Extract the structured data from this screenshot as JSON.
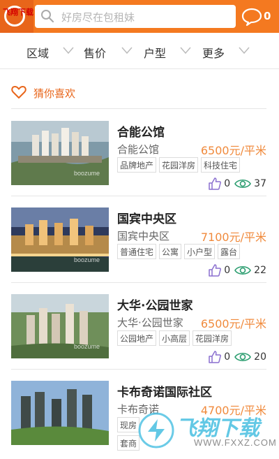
{
  "header": {
    "watermark": "飞翔下载 www.FXXZ.com",
    "search_placeholder": "好房尽在包租妹",
    "message_count": "0",
    "colors": {
      "bar": "#f47920",
      "accent": "#e8651a",
      "price": "#f08a3c",
      "eye": "#2a9d6f",
      "like": "#8a6fcf"
    }
  },
  "filters": [
    {
      "label": "区域",
      "icon": "chevron-down-icon"
    },
    {
      "label": "售价",
      "icon": "chevron-down-icon"
    },
    {
      "label": "户型",
      "icon": "chevron-down-icon"
    },
    {
      "label": "更多",
      "icon": "chevron-down-icon"
    }
  ],
  "section": {
    "title": "猜你喜欢",
    "icon": "heart-icon"
  },
  "listings": [
    {
      "title": "合能公馆",
      "subname": "合能公馆",
      "price": "6500元/平米",
      "tags": [
        "品牌地产",
        "花园洋房",
        "科技住宅"
      ],
      "likes": "0",
      "views": "37"
    },
    {
      "title": "国宾中央区",
      "subname": "国宾中央区",
      "price": "7100元/平米",
      "tags": [
        "普通住宅",
        "公寓",
        "小户型",
        "露台"
      ],
      "likes": "0",
      "views": "22"
    },
    {
      "title": "大华·公园世家",
      "subname": "大华·公园世家",
      "price": "6500元/平米",
      "tags": [
        "公园地产",
        "小高层",
        "花园洋房"
      ],
      "likes": "0",
      "views": "20"
    },
    {
      "title": "卡布奇诺国际社区",
      "subname": "卡布奇诺",
      "price": "4700元/平米",
      "tags": [
        "现房",
        "套商"
      ],
      "likes": "",
      "views": ""
    }
  ],
  "image_watermark": "boozume",
  "footer_watermark": {
    "text": "飞翔下载",
    "url": "WWW.FXXZ.COM"
  }
}
